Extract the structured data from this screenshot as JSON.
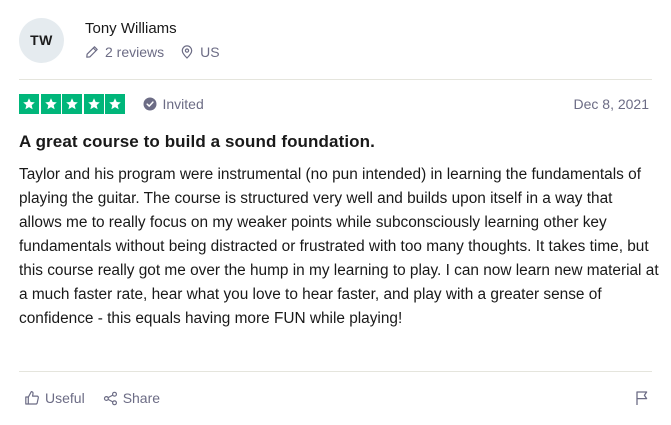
{
  "reviewer": {
    "initials": "TW",
    "name": "Tony Williams",
    "reviews": "2 reviews",
    "country": "US"
  },
  "review": {
    "rating": 5,
    "rating_max": 5,
    "verification": "Invited",
    "date": "Dec 8, 2021",
    "title": "A great course to build a sound foundation.",
    "text": "Taylor and his program were instrumental (no pun intended) in learning the fundamentals of playing the guitar. The course is structured very well and builds upon itself in a way that allows me to really focus on my weaker points while subconsciously learning other key fundamentals without being distracted or frustrated with too many thoughts. It takes time, but this course really got me over the hump in my learning to play. I can now learn new material at a much faster rate, hear what you love to hear faster, and play with a greater sense of confidence - this equals having more FUN while playing!"
  },
  "actions": {
    "useful_label": "Useful",
    "share_label": "Share"
  },
  "colors": {
    "star_green": "#00b67a",
    "muted_text": "#6c6c85",
    "avatar_bg": "#e5ebef"
  },
  "icons": {
    "reviews": "pencil-icon",
    "location": "location-pin-icon",
    "verification": "check-circle-icon",
    "useful": "thumbs-up-icon",
    "share": "share-icon",
    "report": "flag-icon"
  }
}
